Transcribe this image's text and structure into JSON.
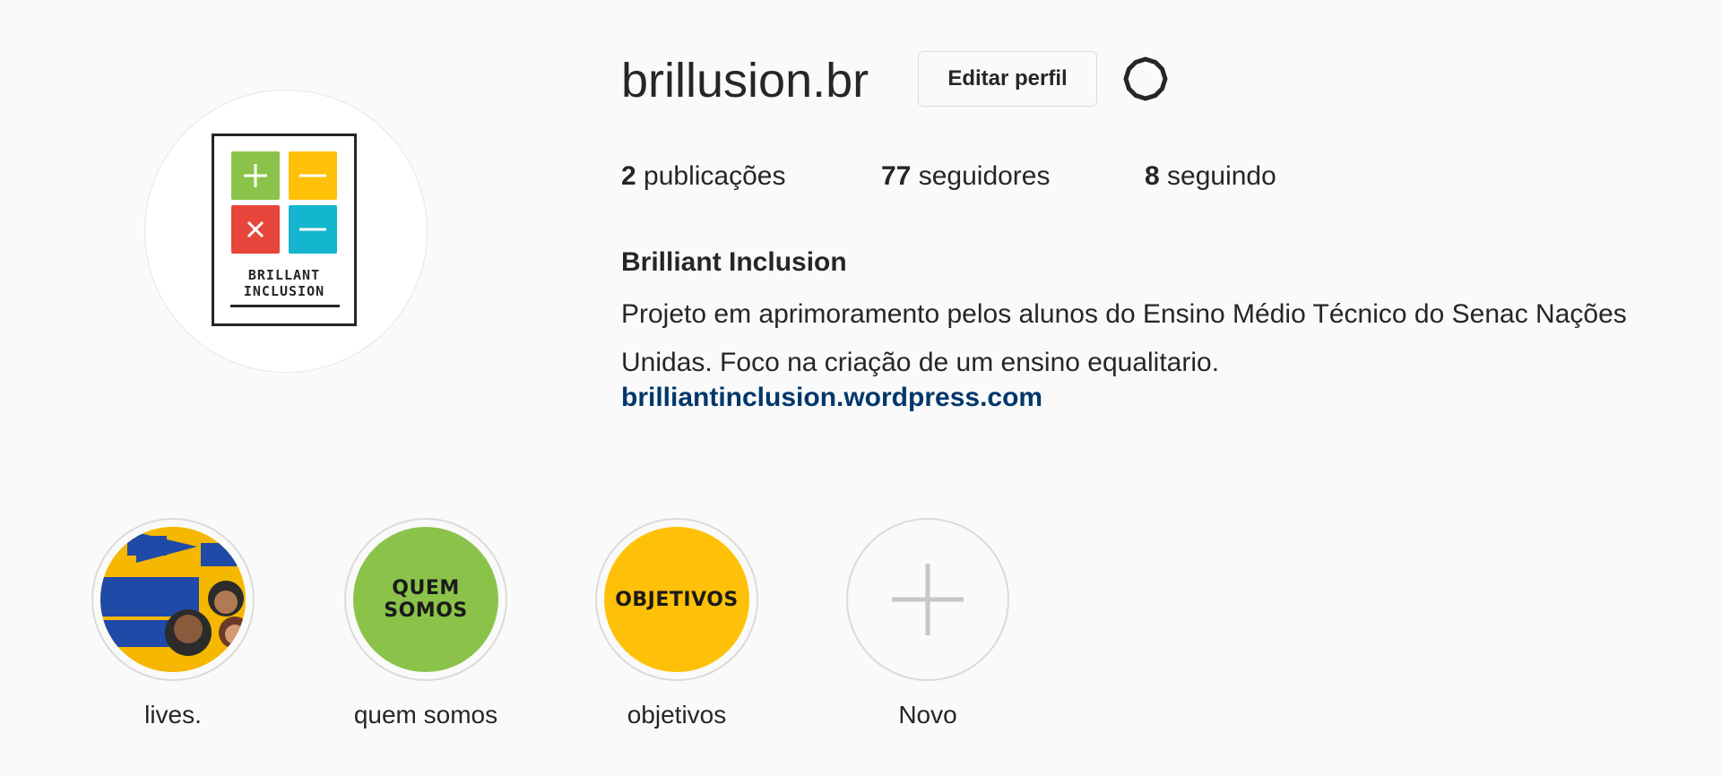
{
  "profile": {
    "username": "brillusion.br",
    "edit_label": "Editar perfil",
    "logo": {
      "line1": "BRILLANT",
      "line2": "INCLUSION"
    },
    "stats": [
      {
        "count": "2",
        "label": "publicações"
      },
      {
        "count": "77",
        "label": "seguidores"
      },
      {
        "count": "8",
        "label": "seguindo"
      }
    ],
    "full_name": "Brilliant Inclusion",
    "bio_lines": [
      "Projeto em aprimoramento pelos alunos do Ensino Médio Técnico do Senac Nações",
      "Unidas. Foco na criação de um ensino equalitario."
    ],
    "link": "brilliantinclusion.wordpress.com"
  },
  "highlights": [
    {
      "label": "lives.",
      "cover_text": "",
      "cover_color": "#f5b700"
    },
    {
      "label": "quem somos",
      "cover_text": "QUEM SOMOS",
      "cover_color": "#8bc34a"
    },
    {
      "label": "objetivos",
      "cover_text": "OBJETIVOS",
      "cover_color": "#ffc107"
    },
    {
      "label": "Novo",
      "cover_text": "",
      "cover_color": "#fafafa"
    }
  ],
  "colors": {
    "link": "#00376b",
    "tile_green": "#8bc34a",
    "tile_yellow": "#ffc107",
    "tile_red": "#e8453c",
    "tile_cyan": "#13b5cf"
  },
  "icons": [
    "gear-icon",
    "plus-icon"
  ]
}
